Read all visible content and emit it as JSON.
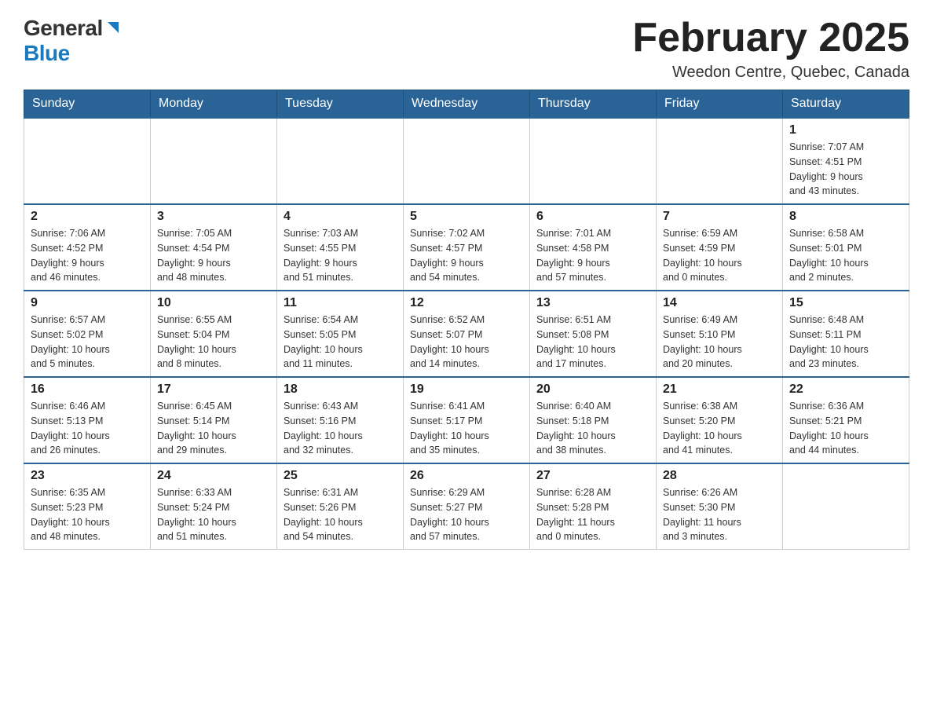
{
  "header": {
    "logo_text_general": "General",
    "logo_text_blue": "Blue",
    "month_title": "February 2025",
    "location": "Weedon Centre, Quebec, Canada"
  },
  "weekdays": [
    "Sunday",
    "Monday",
    "Tuesday",
    "Wednesday",
    "Thursday",
    "Friday",
    "Saturday"
  ],
  "weeks": [
    [
      {
        "day": "",
        "info": ""
      },
      {
        "day": "",
        "info": ""
      },
      {
        "day": "",
        "info": ""
      },
      {
        "day": "",
        "info": ""
      },
      {
        "day": "",
        "info": ""
      },
      {
        "day": "",
        "info": ""
      },
      {
        "day": "1",
        "info": "Sunrise: 7:07 AM\nSunset: 4:51 PM\nDaylight: 9 hours\nand 43 minutes."
      }
    ],
    [
      {
        "day": "2",
        "info": "Sunrise: 7:06 AM\nSunset: 4:52 PM\nDaylight: 9 hours\nand 46 minutes."
      },
      {
        "day": "3",
        "info": "Sunrise: 7:05 AM\nSunset: 4:54 PM\nDaylight: 9 hours\nand 48 minutes."
      },
      {
        "day": "4",
        "info": "Sunrise: 7:03 AM\nSunset: 4:55 PM\nDaylight: 9 hours\nand 51 minutes."
      },
      {
        "day": "5",
        "info": "Sunrise: 7:02 AM\nSunset: 4:57 PM\nDaylight: 9 hours\nand 54 minutes."
      },
      {
        "day": "6",
        "info": "Sunrise: 7:01 AM\nSunset: 4:58 PM\nDaylight: 9 hours\nand 57 minutes."
      },
      {
        "day": "7",
        "info": "Sunrise: 6:59 AM\nSunset: 4:59 PM\nDaylight: 10 hours\nand 0 minutes."
      },
      {
        "day": "8",
        "info": "Sunrise: 6:58 AM\nSunset: 5:01 PM\nDaylight: 10 hours\nand 2 minutes."
      }
    ],
    [
      {
        "day": "9",
        "info": "Sunrise: 6:57 AM\nSunset: 5:02 PM\nDaylight: 10 hours\nand 5 minutes."
      },
      {
        "day": "10",
        "info": "Sunrise: 6:55 AM\nSunset: 5:04 PM\nDaylight: 10 hours\nand 8 minutes."
      },
      {
        "day": "11",
        "info": "Sunrise: 6:54 AM\nSunset: 5:05 PM\nDaylight: 10 hours\nand 11 minutes."
      },
      {
        "day": "12",
        "info": "Sunrise: 6:52 AM\nSunset: 5:07 PM\nDaylight: 10 hours\nand 14 minutes."
      },
      {
        "day": "13",
        "info": "Sunrise: 6:51 AM\nSunset: 5:08 PM\nDaylight: 10 hours\nand 17 minutes."
      },
      {
        "day": "14",
        "info": "Sunrise: 6:49 AM\nSunset: 5:10 PM\nDaylight: 10 hours\nand 20 minutes."
      },
      {
        "day": "15",
        "info": "Sunrise: 6:48 AM\nSunset: 5:11 PM\nDaylight: 10 hours\nand 23 minutes."
      }
    ],
    [
      {
        "day": "16",
        "info": "Sunrise: 6:46 AM\nSunset: 5:13 PM\nDaylight: 10 hours\nand 26 minutes."
      },
      {
        "day": "17",
        "info": "Sunrise: 6:45 AM\nSunset: 5:14 PM\nDaylight: 10 hours\nand 29 minutes."
      },
      {
        "day": "18",
        "info": "Sunrise: 6:43 AM\nSunset: 5:16 PM\nDaylight: 10 hours\nand 32 minutes."
      },
      {
        "day": "19",
        "info": "Sunrise: 6:41 AM\nSunset: 5:17 PM\nDaylight: 10 hours\nand 35 minutes."
      },
      {
        "day": "20",
        "info": "Sunrise: 6:40 AM\nSunset: 5:18 PM\nDaylight: 10 hours\nand 38 minutes."
      },
      {
        "day": "21",
        "info": "Sunrise: 6:38 AM\nSunset: 5:20 PM\nDaylight: 10 hours\nand 41 minutes."
      },
      {
        "day": "22",
        "info": "Sunrise: 6:36 AM\nSunset: 5:21 PM\nDaylight: 10 hours\nand 44 minutes."
      }
    ],
    [
      {
        "day": "23",
        "info": "Sunrise: 6:35 AM\nSunset: 5:23 PM\nDaylight: 10 hours\nand 48 minutes."
      },
      {
        "day": "24",
        "info": "Sunrise: 6:33 AM\nSunset: 5:24 PM\nDaylight: 10 hours\nand 51 minutes."
      },
      {
        "day": "25",
        "info": "Sunrise: 6:31 AM\nSunset: 5:26 PM\nDaylight: 10 hours\nand 54 minutes."
      },
      {
        "day": "26",
        "info": "Sunrise: 6:29 AM\nSunset: 5:27 PM\nDaylight: 10 hours\nand 57 minutes."
      },
      {
        "day": "27",
        "info": "Sunrise: 6:28 AM\nSunset: 5:28 PM\nDaylight: 11 hours\nand 0 minutes."
      },
      {
        "day": "28",
        "info": "Sunrise: 6:26 AM\nSunset: 5:30 PM\nDaylight: 11 hours\nand 3 minutes."
      },
      {
        "day": "",
        "info": ""
      }
    ]
  ]
}
